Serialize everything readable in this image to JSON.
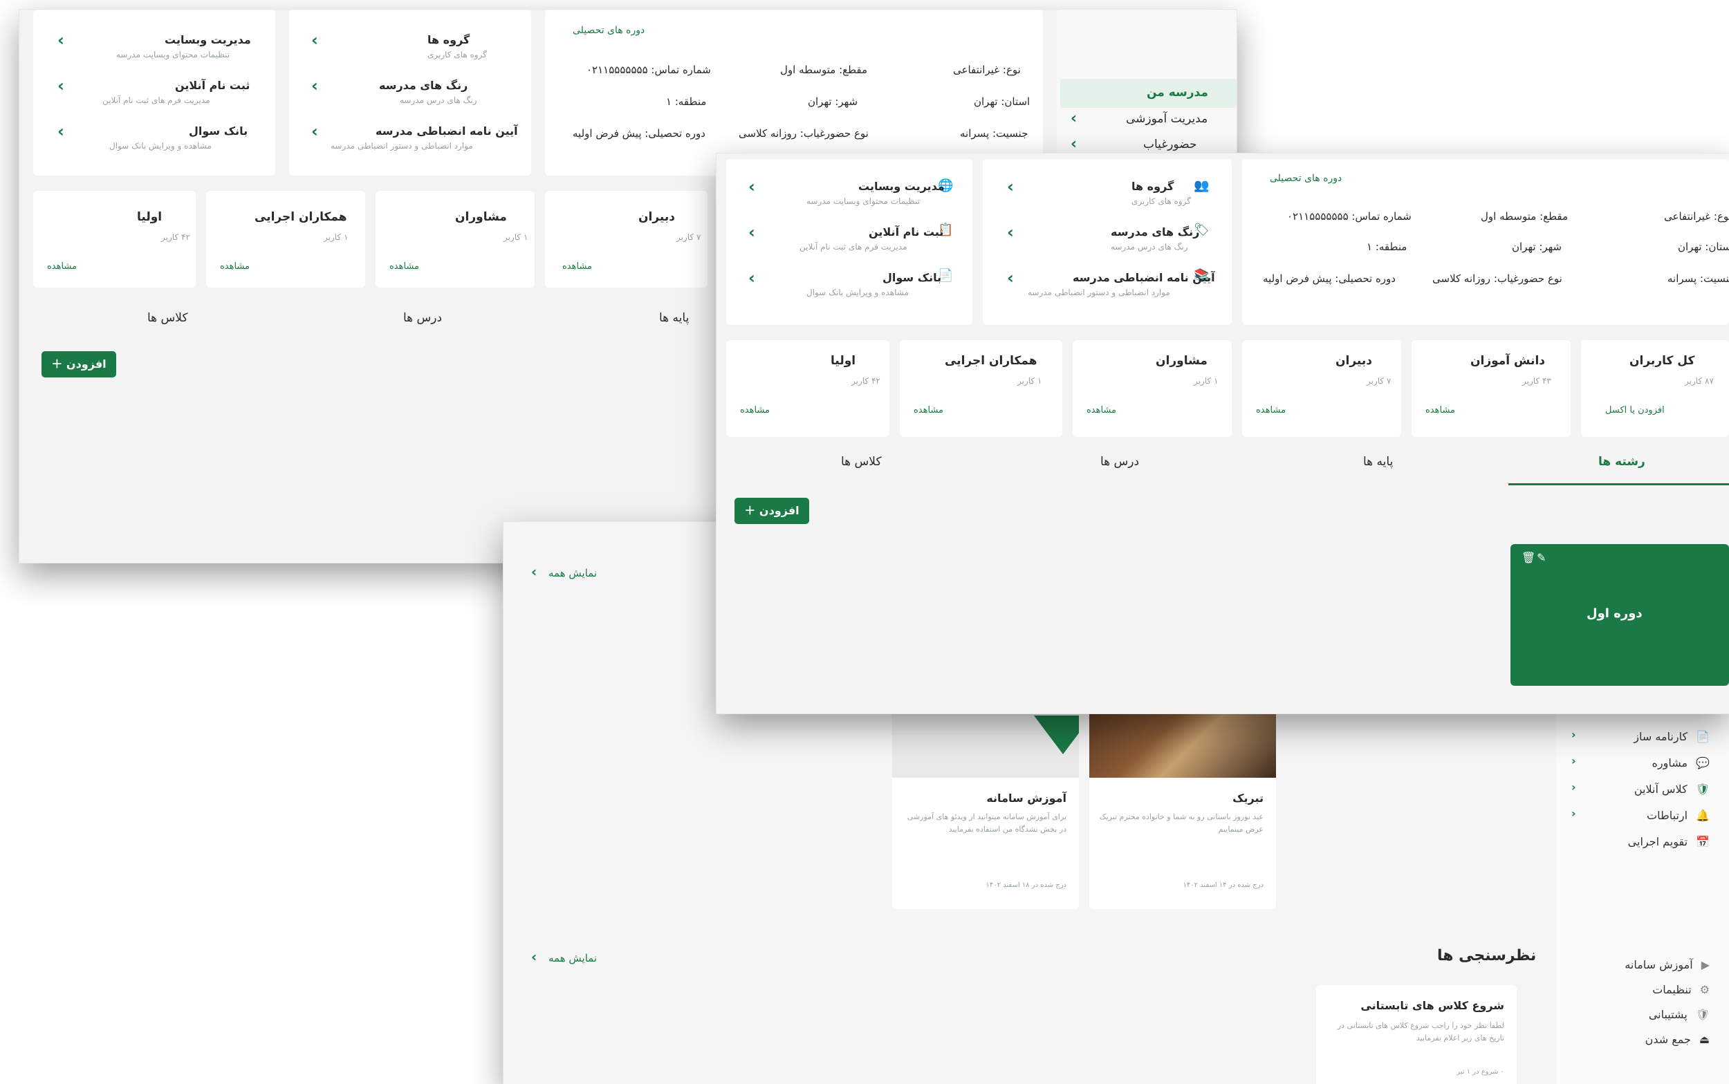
{
  "icons": {
    "chevron": "‹",
    "group": "👥",
    "web": "🌐",
    "book": "📚",
    "check": "✔",
    "user": "👤",
    "plus": "＋",
    "tag": "🏷",
    "home": "🏠",
    "gear": "⚙",
    "edit": "✎",
    "trash": "🗑",
    "clip": "📋",
    "cal": "📅",
    "link": "🔗",
    "chat": "💬",
    "shield": "🛡",
    "bell": "🔔",
    "doc": "📄",
    "play": "▶",
    "exit": "⏏"
  },
  "school": {
    "type": "نوع: غیرانتفاعی",
    "grade": "مقطع: متوسطه اول",
    "phone": "شماره تماس: ۰۲۱۱۵۵۵۵۵۵۵",
    "province": "استان: تهران",
    "city": "شهر: تهران",
    "region": "منطقه: ۱",
    "gender": "جنسیت: پسرانه",
    "attendance": "نوع حضورغیاب: روزانه کلاسی",
    "period": "دوره تحصیلی: پیش فرض اولیه",
    "periods_link": "دوره های تحصیلی"
  },
  "services": [
    {
      "title": "گروه ها",
      "desc": "گروه های کاربری"
    },
    {
      "title": "رنگ های مدرسه",
      "desc": "رنگ های درس مدرسه"
    },
    {
      "title": "آیین نامه انضباطی مدرسه",
      "desc": "موارد انضباطی و دستور انضباطی مدرسه"
    },
    {
      "title": "مدیریت وبسایت",
      "desc": "تنظیمات محتوای وبسایت مدرسه"
    },
    {
      "title": "ثبت نام آنلاین",
      "desc": "مدیریت فرم های ثبت نام آنلاین"
    },
    {
      "title": "بانک سوال",
      "desc": "مشاهده و ویرایش بانک سوال"
    }
  ],
  "stats": [
    {
      "title": "کل کاربران",
      "count": "۸۷ کاربر",
      "link": "افزودن یا اکسل",
      "key": "all"
    },
    {
      "title": "دانش آموزان",
      "count": "۴۳ کاربر",
      "link": "مشاهده",
      "key": "students"
    },
    {
      "title": "دبیران",
      "count": "۷ کاربر",
      "link": "مشاهده",
      "key": "teachers"
    },
    {
      "title": "مشاوران",
      "count": "۱ کاربر",
      "link": "مشاهده",
      "key": "advisors"
    },
    {
      "title": "همکاران اجرایی",
      "count": "۱ کاربر",
      "link": "مشاهده",
      "key": "staff"
    },
    {
      "title": "اولیا",
      "count": "۴۲ کاربر",
      "link": "مشاهده",
      "key": "parents"
    }
  ],
  "tabs": [
    "رشته ها",
    "پایه ها",
    "درس ها",
    "کلاس ها"
  ],
  "add_label": "افزودن",
  "period_card": "دوره اول",
  "sidebar_top": [
    "مدرسه من",
    "مدیریت آموزشی",
    "حضورغیاب"
  ],
  "sidebar_mid": [
    "کارنامه ساز",
    "مشاوره",
    "کلاس آنلاین",
    "ارتباطات",
    "تقویم اجرایی"
  ],
  "sidebar_bottom": [
    "آموزش سامانه",
    "تنظیمات",
    "پشتیبانی",
    "جمع شدن"
  ],
  "show_all": "نمایش همه",
  "news": [
    {
      "title": "تبریک",
      "desc": "عید نوروز باستانی رو به شما و خانواده محترم تبریک عرض مینماییم",
      "meta": "درج شده در ۱۴ اسفند ۱۴۰۲"
    },
    {
      "title": "آموزش سامانه",
      "desc": "برای آموزش سامانه میتوانید از ویدئو های آموزشی در بخش نشدگاه من استفاده بفرمایید",
      "meta": "درج شده در ۱۸ اسفند ۱۴۰۲"
    }
  ],
  "polls_title": "نظرسنجی ها",
  "poll": {
    "title": "شروع کلاس های تابستانی",
    "desc": "لطفا نظر خود را راجب شروع کلاس های تابستانی در تاریخ های زیر اعلام بفرمایید",
    "meta": "۰ شروع در ۱ تیر"
  }
}
